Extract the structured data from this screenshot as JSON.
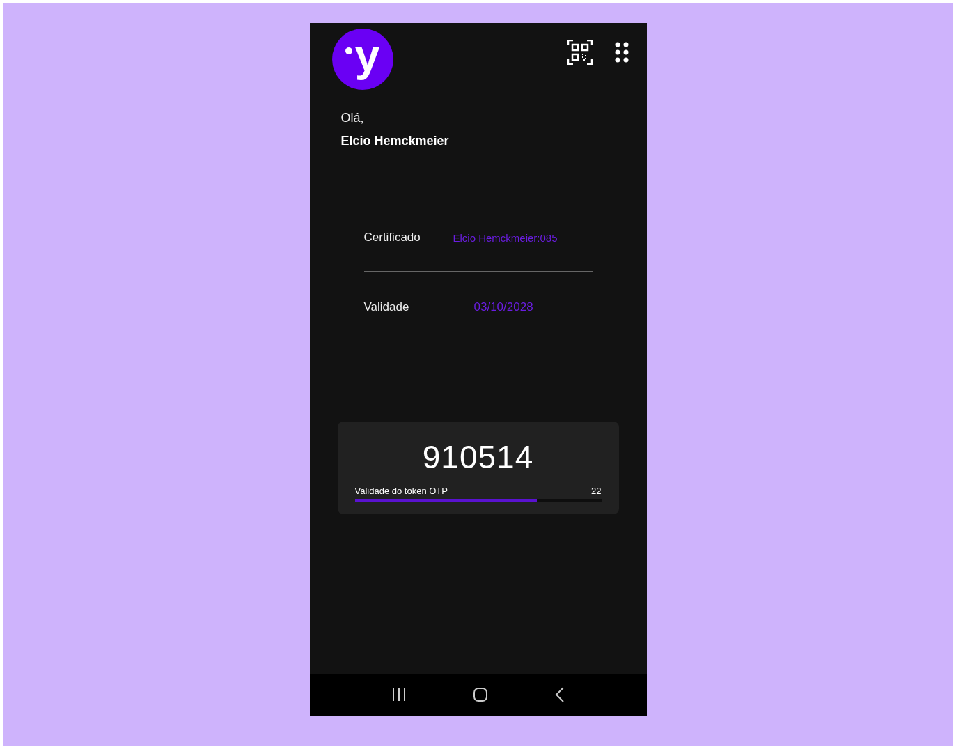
{
  "header": {
    "logo": "y"
  },
  "greeting": {
    "hello": "Olá,",
    "name": "Elcio Hemckmeier"
  },
  "fields": [
    {
      "label": "Certificado",
      "value": "Elcio Hemckmeier:085"
    },
    {
      "label": "Validade",
      "value": "03/10/2028"
    }
  ],
  "token": {
    "code": "910514",
    "label": "Validade do token OTP",
    "seconds": "22",
    "level": 0.74
  }
}
